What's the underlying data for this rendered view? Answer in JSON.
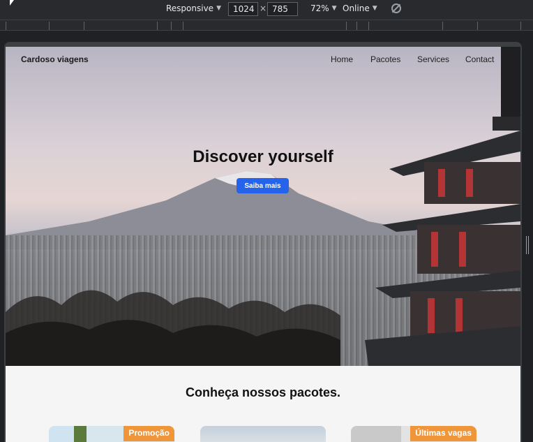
{
  "devtools": {
    "device": "Responsive",
    "width": "1024",
    "height": "785",
    "zoom": "72%",
    "throttle": "Online"
  },
  "site": {
    "brand": "Cardoso viagens",
    "nav": [
      "Home",
      "Pacotes",
      "Services",
      "Contact"
    ],
    "hero_title": "Discover yourself",
    "hero_button": "Saiba mais",
    "section_title": "Conheça nossos pacotes.",
    "cards": [
      {
        "badge": "Promoção"
      },
      {
        "badge": ""
      },
      {
        "badge": "Últimas vagas"
      }
    ]
  },
  "colors": {
    "accent": "#2563eb",
    "badge": "#f0963a"
  }
}
